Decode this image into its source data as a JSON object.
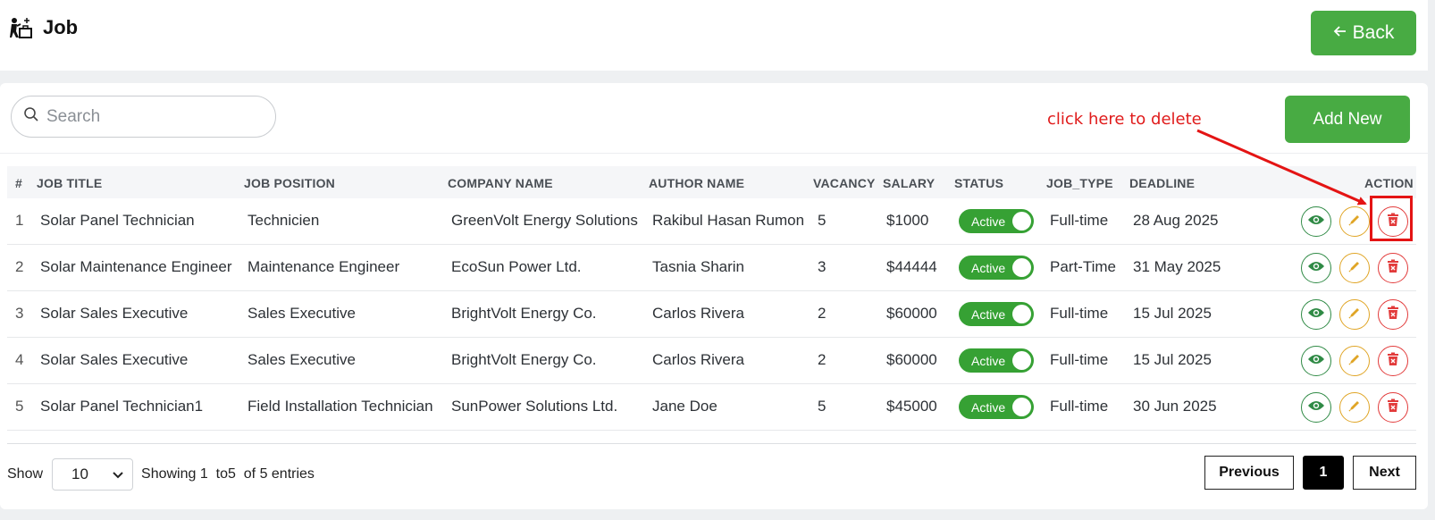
{
  "header": {
    "title": "Job",
    "icon": "job-seeker-icon",
    "back_label": "Back"
  },
  "toolbar": {
    "search_placeholder": "Search",
    "add_label": "Add New",
    "annotation": "click here to delete"
  },
  "table": {
    "columns": [
      "#",
      "JOB TITLE",
      "JOB POSITION",
      "COMPANY NAME",
      "AUTHOR NAME",
      "VACANCY",
      "SALARY",
      "STATUS",
      "JOB_TYPE",
      "DEADLINE",
      "ACTION"
    ],
    "rows": [
      {
        "idx": "1",
        "title": "Solar Panel Technician",
        "position": "Technicien",
        "company": "GreenVolt Energy Solutions",
        "author": "Rakibul Hasan Rumon",
        "vacancy": "5",
        "salary": "$1000",
        "status": "Active",
        "type": "Full-time",
        "deadline": "28 Aug 2025"
      },
      {
        "idx": "2",
        "title": "Solar Maintenance Engineer",
        "position": "Maintenance Engineer",
        "company": "EcoSun Power Ltd.",
        "author": "Tasnia Sharin",
        "vacancy": "3",
        "salary": "$44444",
        "status": "Active",
        "type": "Part-Time",
        "deadline": "31 May 2025"
      },
      {
        "idx": "3",
        "title": "Solar Sales Executive",
        "position": "Sales Executive",
        "company": "BrightVolt Energy Co.",
        "author": "Carlos Rivera",
        "vacancy": "2",
        "salary": "$60000",
        "status": "Active",
        "type": "Full-time",
        "deadline": "15 Jul 2025"
      },
      {
        "idx": "4",
        "title": "Solar Sales Executive",
        "position": "Sales Executive",
        "company": "BrightVolt Energy Co.",
        "author": "Carlos Rivera",
        "vacancy": "2",
        "salary": "$60000",
        "status": "Active",
        "type": "Full-time",
        "deadline": "15 Jul 2025"
      },
      {
        "idx": "5",
        "title": "Solar Panel Technician1",
        "position": "Field Installation Technician",
        "company": "SunPower Solutions Ltd.",
        "author": "Jane Doe",
        "vacancy": "5",
        "salary": "$45000",
        "status": "Active",
        "type": "Full-time",
        "deadline": "30 Jun 2025"
      }
    ]
  },
  "footer": {
    "show_label": "Show",
    "page_size": "10",
    "showing_text": "Showing 1  to5  of 5 entries",
    "prev_label": "Previous",
    "current_page": "1",
    "next_label": "Next"
  },
  "colors": {
    "primary_green": "#48ab43",
    "toggle_green": "#36a134",
    "view": "#2f8a45",
    "edit": "#e0a526",
    "delete": "#e23b3b",
    "annotation": "#e01b1b"
  }
}
